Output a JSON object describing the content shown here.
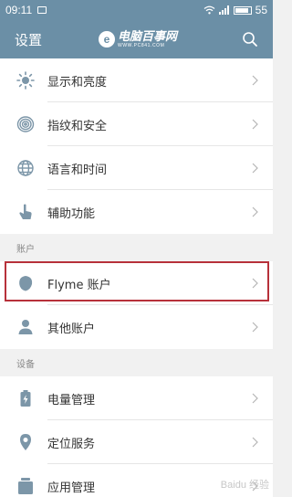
{
  "status_bar": {
    "time": "09:11",
    "battery": "55"
  },
  "header": {
    "title": "设置",
    "logo_text": "电脑百事网",
    "logo_sub": "WWW.PC841.COM",
    "logo_mark": "e"
  },
  "sections": [
    {
      "title": "",
      "items": [
        {
          "label": "显示和亮度",
          "icon": "brightness-icon"
        },
        {
          "label": "指纹和安全",
          "icon": "fingerprint-icon"
        },
        {
          "label": "语言和时间",
          "icon": "globe-icon"
        },
        {
          "label": "辅助功能",
          "icon": "hand-icon"
        }
      ]
    },
    {
      "title": "账户",
      "items": [
        {
          "label": "Flyme 账户",
          "icon": "flyme-leaf-icon"
        },
        {
          "label": "其他账户",
          "icon": "person-icon"
        }
      ]
    },
    {
      "title": "设备",
      "items": [
        {
          "label": "电量管理",
          "icon": "battery-icon"
        },
        {
          "label": "定位服务",
          "icon": "location-icon"
        },
        {
          "label": "应用管理",
          "icon": "apps-icon"
        }
      ]
    }
  ],
  "watermark": "Baidu 经验",
  "colors": {
    "header": "#6b8fa6",
    "highlight": "#b7313a",
    "icon": "#7c96a8"
  }
}
